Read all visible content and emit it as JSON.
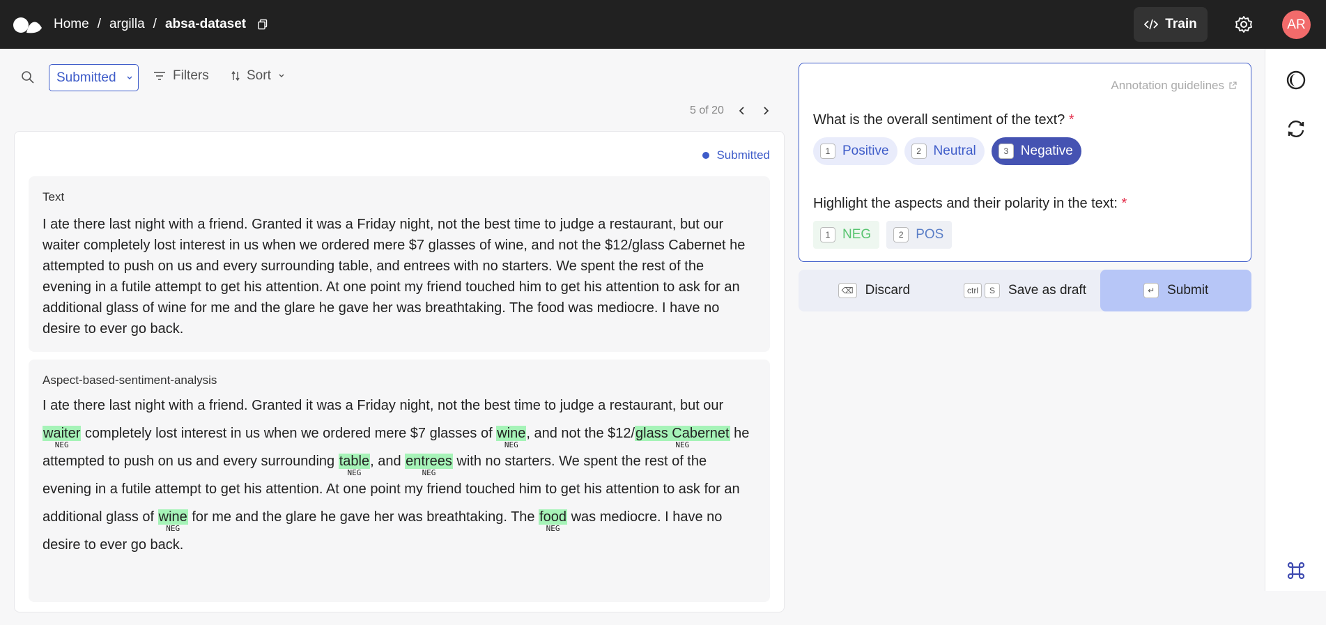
{
  "header": {
    "breadcrumbs": [
      "Home",
      "argilla",
      "absa-dataset"
    ],
    "train_label": "Train",
    "avatar_initials": "AR"
  },
  "toolbar": {
    "status_filter": "Submitted",
    "filters_label": "Filters",
    "sort_label": "Sort",
    "pagination": "5 of 20"
  },
  "record": {
    "status": "Submitted",
    "text_field": {
      "title": "Text",
      "value": "I ate there last night with a friend. Granted it was a Friday night, not the best time to judge a restaurant, but our waiter completely lost interest in us when we ordered mere $7 glasses of wine, and not the $12/glass Cabernet he attempted to push on us and every surrounding table, and entrees with no starters. We spent the rest of the evening in a futile attempt to get his attention. At one point my friend touched him to get his attention to ask for an additional glass of wine for me and the glare he gave her was breathtaking. The food was mediocre. I have no desire to ever go back."
    },
    "absa_field": {
      "title": "Aspect-based-sentiment-analysis",
      "segments": [
        {
          "text": "I ate there last night with a friend. Granted it was a Friday night, not the best time to judge a restaurant, but our "
        },
        {
          "text": "waiter",
          "label": "NEG"
        },
        {
          "text": " completely lost interest in us when we ordered mere $7 glasses of "
        },
        {
          "text": "wine",
          "label": "NEG"
        },
        {
          "text": ", and not the $12/"
        },
        {
          "text": "glass Cabernet",
          "label": "NEG"
        },
        {
          "text": " he attempted to push on us and every surrounding "
        },
        {
          "text": "table",
          "label": "NEG"
        },
        {
          "text": ", and "
        },
        {
          "text": "entrees",
          "label": "NEG"
        },
        {
          "text": " with no starters. We spent the rest of the evening in a futile attempt to get his attention. At one point my friend touched him to get his attention to ask for an additional glass of "
        },
        {
          "text": "wine",
          "label": "NEG"
        },
        {
          "text": " for me and the glare he gave her was breathtaking. The "
        },
        {
          "text": "food",
          "label": "NEG"
        },
        {
          "text": " was mediocre. I have no desire to ever go back."
        }
      ]
    }
  },
  "questions": {
    "guidelines_label": "Annotation guidelines",
    "sentiment": {
      "title": "What is the overall sentiment of the text?",
      "required_mark": "*",
      "options": [
        {
          "key": "1",
          "label": "Positive",
          "selected": false
        },
        {
          "key": "2",
          "label": "Neutral",
          "selected": false
        },
        {
          "key": "3",
          "label": "Negative",
          "selected": true
        }
      ]
    },
    "aspects": {
      "title": "Highlight the aspects and their polarity in the text:",
      "required_mark": "*",
      "labels": [
        {
          "key": "1",
          "label": "NEG"
        },
        {
          "key": "2",
          "label": "POS"
        }
      ]
    }
  },
  "actions": {
    "discard_key": "⌫",
    "discard_label": "Discard",
    "draft_keys": [
      "ctrl",
      "S"
    ],
    "draft_label": "Save as draft",
    "submit_key": "↵",
    "submit_label": "Submit"
  },
  "icons": [
    "logo-icon",
    "copy-icon",
    "code-icon",
    "gear-icon",
    "search-icon",
    "chevron-down-icon",
    "filter-icon",
    "sort-icon",
    "chevron-left-icon",
    "chevron-right-icon",
    "external-link-icon",
    "theme-icon",
    "refresh-icon",
    "command-icon"
  ],
  "colors": {
    "accent": "#3e5cc9",
    "selected_option": "#4553b2",
    "span_highlight": "#a6f3b8",
    "avatar": "#f26b6b",
    "topbar": "#212121",
    "submit_bg": "#b7c6f7"
  }
}
